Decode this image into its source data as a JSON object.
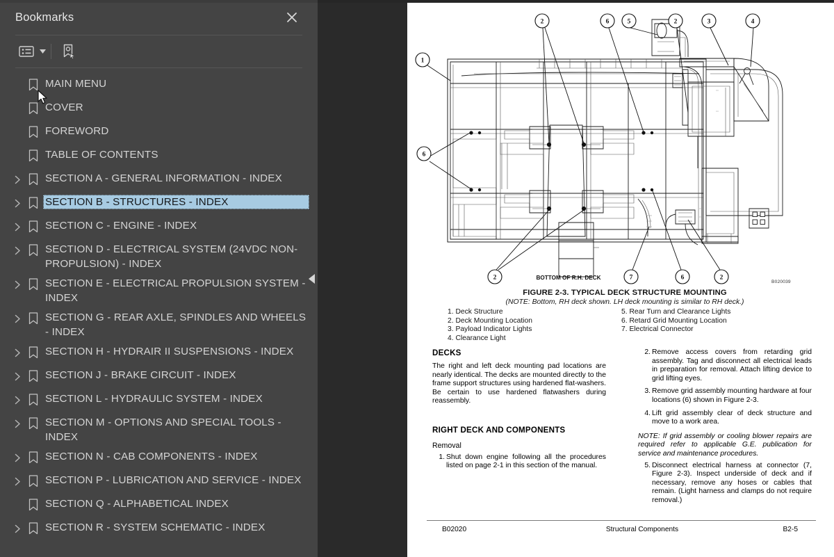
{
  "panel": {
    "title": "Bookmarks",
    "close_label": "Close",
    "toolbar": {
      "options_icon": "list-options-icon",
      "caret_icon": "chevron-down-icon",
      "new_bookmark_icon": "new-bookmark-icon"
    },
    "collapse_icon": "collapse-left-arrow-icon",
    "selected_color": "#a7cbe2"
  },
  "bookmarks": [
    {
      "label": "MAIN MENU",
      "expandable": false,
      "selected": false
    },
    {
      "label": "COVER",
      "expandable": false,
      "selected": false
    },
    {
      "label": "FOREWORD",
      "expandable": false,
      "selected": false
    },
    {
      "label": "TABLE OF CONTENTS",
      "expandable": false,
      "selected": false
    },
    {
      "label": "SECTION A - GENERAL INFORMATION - INDEX",
      "expandable": true,
      "selected": false
    },
    {
      "label": "SECTION B - STRUCTURES - INDEX",
      "expandable": true,
      "selected": true
    },
    {
      "label": "SECTION C - ENGINE - INDEX",
      "expandable": true,
      "selected": false
    },
    {
      "label": "SECTION D - ELECTRICAL SYSTEM (24VDC NON-PROPULSION) - INDEX",
      "expandable": true,
      "selected": false
    },
    {
      "label": "SECTION E - ELECTRICAL PROPULSION SYSTEM - INDEX",
      "expandable": true,
      "selected": false
    },
    {
      "label": "SECTION G - REAR AXLE, SPINDLES AND WHEELS - INDEX",
      "expandable": true,
      "selected": false
    },
    {
      "label": "SECTION H - HYDRAIR II SUSPENSIONS - INDEX",
      "expandable": true,
      "selected": false
    },
    {
      "label": "SECTION J - BRAKE CIRCUIT - INDEX",
      "expandable": true,
      "selected": false
    },
    {
      "label": "SECTION L - HYDRAULIC SYSTEM - INDEX",
      "expandable": true,
      "selected": false
    },
    {
      "label": "SECTION M - OPTIONS AND SPECIAL TOOLS - INDEX",
      "expandable": true,
      "selected": false
    },
    {
      "label": "SECTION N - CAB COMPONENTS - INDEX",
      "expandable": true,
      "selected": false
    },
    {
      "label": "SECTION P - LUBRICATION AND SERVICE - INDEX",
      "expandable": true,
      "selected": false
    },
    {
      "label": "SECTION Q - ALPHABETICAL INDEX",
      "expandable": false,
      "selected": false
    },
    {
      "label": "SECTION R - SYSTEM SCHEMATIC - INDEX",
      "expandable": true,
      "selected": false
    }
  ],
  "document": {
    "figure": {
      "view_label": "BOTTOM OF R.H. DECK",
      "caption": "FIGURE 2-3. TYPICAL DECK STRUCTURE MOUNTING",
      "note": "(NOTE: Bottom, RH deck shown. LH deck mounting is similar to RH deck.)",
      "drawing_number": "B020039",
      "callouts": [
        "1",
        "2",
        "3",
        "4",
        "5",
        "6",
        "7"
      ],
      "legend_left": [
        "1. Deck Structure",
        "2. Deck Mounting Location",
        "3. Payload Indicator Lights",
        "4. Clearance Light"
      ],
      "legend_right": [
        "5. Rear Turn and Clearance Lights",
        "6. Retard Grid Mounting Location",
        "7. Electrical Connector"
      ]
    },
    "left_column": {
      "heading1": "DECKS",
      "para1": "The right and left deck mounting pad locations are nearly identical. The decks are mounted directly to the frame support structures using hardened flat-washers. Be certain to use hardened flatwashers during reassembly.",
      "heading2": "RIGHT DECK AND COMPONENTS",
      "subheading": "Removal",
      "steps": [
        {
          "num": "1.",
          "text": "Shut down engine following all the procedures listed on page 2-1 in this section of the manual."
        }
      ]
    },
    "right_column": {
      "steps_top": [
        {
          "num": "2.",
          "text": "Remove access covers from retarding grid assembly. Tag and disconnect all electrical leads in preparation for removal. Attach lifting device to grid lifting eyes."
        },
        {
          "num": "3.",
          "text": "Remove grid assembly mounting hardware at four locations (6) shown in Figure 2-3."
        },
        {
          "num": "4.",
          "text": "Lift grid assembly clear of deck structure and move to a work area."
        }
      ],
      "note": "NOTE: If grid assembly or cooling blower repairs are required refer to applicable G.E. publication for service and maintenance procedures.",
      "steps_bottom": [
        {
          "num": "5.",
          "text": "Disconnect electrical harness at connector (7, Figure 2-3). Inspect underside of deck and if necessary, remove any hoses or cables that remain. (Light harness and clamps do not require removal.)"
        }
      ]
    },
    "footer": {
      "left": "B02020",
      "center": "Structural Components",
      "right": "B2-5"
    }
  }
}
